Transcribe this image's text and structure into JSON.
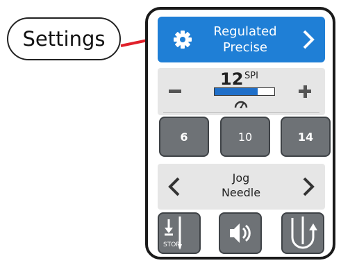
{
  "callout": {
    "label": "Settings"
  },
  "mode_button": {
    "line1": "Regulated",
    "line2": "Precise",
    "icon": "gear-icon",
    "chevron": "chevron-right-icon"
  },
  "stitch_length": {
    "value": "12",
    "unit": "SPI",
    "level_fraction": 0.72,
    "minus_icon": "minus-icon",
    "plus_icon": "plus-icon",
    "gauge_icon": "speedometer-icon"
  },
  "presets": [
    "6",
    "10",
    "14"
  ],
  "jog": {
    "line1": "Jog",
    "line2": "Needle",
    "left_icon": "chevron-left-icon",
    "right_icon": "chevron-right-icon"
  },
  "bottom_buttons": {
    "stop_label": "STOP",
    "sound_icon": "speaker-icon",
    "thread_icon": "needle-up-icon"
  },
  "colors": {
    "accent": "#1f7fd6",
    "callout_arrow": "#e0202a",
    "button_dark": "#6e7276",
    "panel_light": "#e6e6e6"
  }
}
